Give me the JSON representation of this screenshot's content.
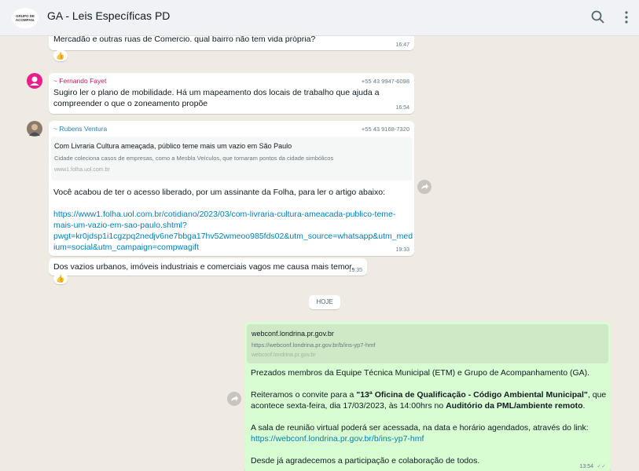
{
  "header": {
    "logo_line1": "GRUPO DE",
    "logo_line2": "ACOMPAN.",
    "title": "GA - Leis Específicas PD"
  },
  "messages": {
    "m1": {
      "text": "Mercadão e outras ruas de Comercio. qual bairro não tem vida própria?",
      "time": "16:47",
      "reaction": "👍"
    },
    "m2": {
      "sender": "~ Fernando Fayet",
      "phone": "+55 43 9947-6098",
      "line1": "Sugiro ler o plano de mobilidade. Há um mapeamento dos locais de trabalho que ajuda a",
      "line2": "compreender o que o zoneamento propõe",
      "time": "16:54"
    },
    "m3": {
      "sender": "~ Rubens Ventura",
      "phone": "+55 43 9168-7320",
      "preview_title": "Com Livraria Cultura ameaçada, público teme mais um vazio em São Paulo",
      "preview_desc": "Cidade coleciona casos de empresas, como a Mesbla Veículos, que tornaram pontos da cidade simbólicos",
      "preview_domain": "www1.folha.uol.com.br",
      "body": "Você acabou de ter o acesso liberado, por um assinante da Folha, para ler o artigo abaixo:",
      "link1": "https://www1.folha.uol.com.br/cotidiano/2023/03/com-livraria-cultura-ameacada-publico-teme-",
      "link2": "mais-um-vazio-em-sao-paulo.shtml?",
      "link3": "pwgt=kr0jdsp1i1cgzpq2nedjv6ne7bbga17hv52wmeoo985fds02&utm_source=whatsapp&utm_med",
      "link4": "ium=social&utm_campaign=compwagift",
      "time": "19:33"
    },
    "m4": {
      "text": "Dos vazios urbanos, imóveis industriais e comerciais vagos me causa mais temor.",
      "time": "19:35",
      "reaction": "👍"
    },
    "day_label": "HOJE",
    "m5": {
      "preview_title": "webconf.londrina.pr.gov.br",
      "preview_url": "https://webconf.londrina.pr.gov.br/b/ins-yp7-hmf",
      "preview_domain": "webconf.londrina.pr.gov.br",
      "p1": "Prezados membros da Equipe Técnica Municipal (ETM) e Grupo de Acompanhamento (GA).",
      "p2a": "Reiteramos o convite para a ",
      "p2b": "\"13ª Oficina de Qualificação - Código Ambiental Municipal\"",
      "p2c": ", que",
      "p3a": "acontece sexta-feira, dia 17/03/2023, às 14:00hrs no ",
      "p3b": "Auditório da PML/ambiente remoto",
      "p3c": ".",
      "p4": "A sala de reunião virtual poderá ser acessada, na data e horário agendados, através do link:",
      "p5": "https://webconf.londrina.pr.gov.br/b/ins-yp7-hmf",
      "p6": "Desde já agradecemos a participação e colaboração de todos.",
      "time": "13:54",
      "status": "✓✓"
    }
  },
  "colors": {
    "fernando": "#c2185b",
    "rubens": "#2e7fb8",
    "outgoing": "#d9fdd3",
    "link": "#027eb5"
  }
}
